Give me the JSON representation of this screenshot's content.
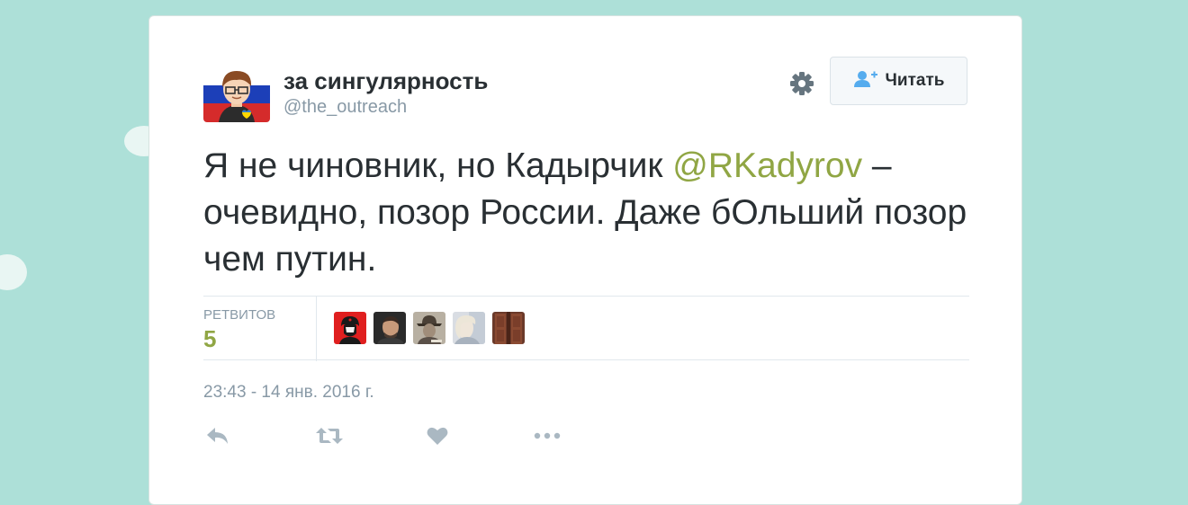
{
  "tweet": {
    "author": {
      "name": "за сингулярность",
      "handle": "@the_outreach"
    },
    "follow_label": "Читать",
    "text_before_mention": "Я не чиновник, но Кадырчик ",
    "mention": "@RKadyrov",
    "text_after_mention": " – очевидно, позор России. Даже бОльший позор чем путин.",
    "stats": {
      "retweets_label": "РЕТВИТОВ",
      "retweets_count": "5"
    },
    "timestamp": "23:43 - 14 янв. 2016 г."
  },
  "colors": {
    "background": "#ade0d8",
    "accent": "#90a644",
    "text": "#292f33",
    "muted": "#8899a6",
    "follow_icon": "#55acee"
  },
  "icons": {
    "settings": "gear-icon",
    "follow": "person-add-icon",
    "reply": "reply-icon",
    "retweet": "retweet-icon",
    "like": "heart-icon",
    "more": "more-icon"
  }
}
